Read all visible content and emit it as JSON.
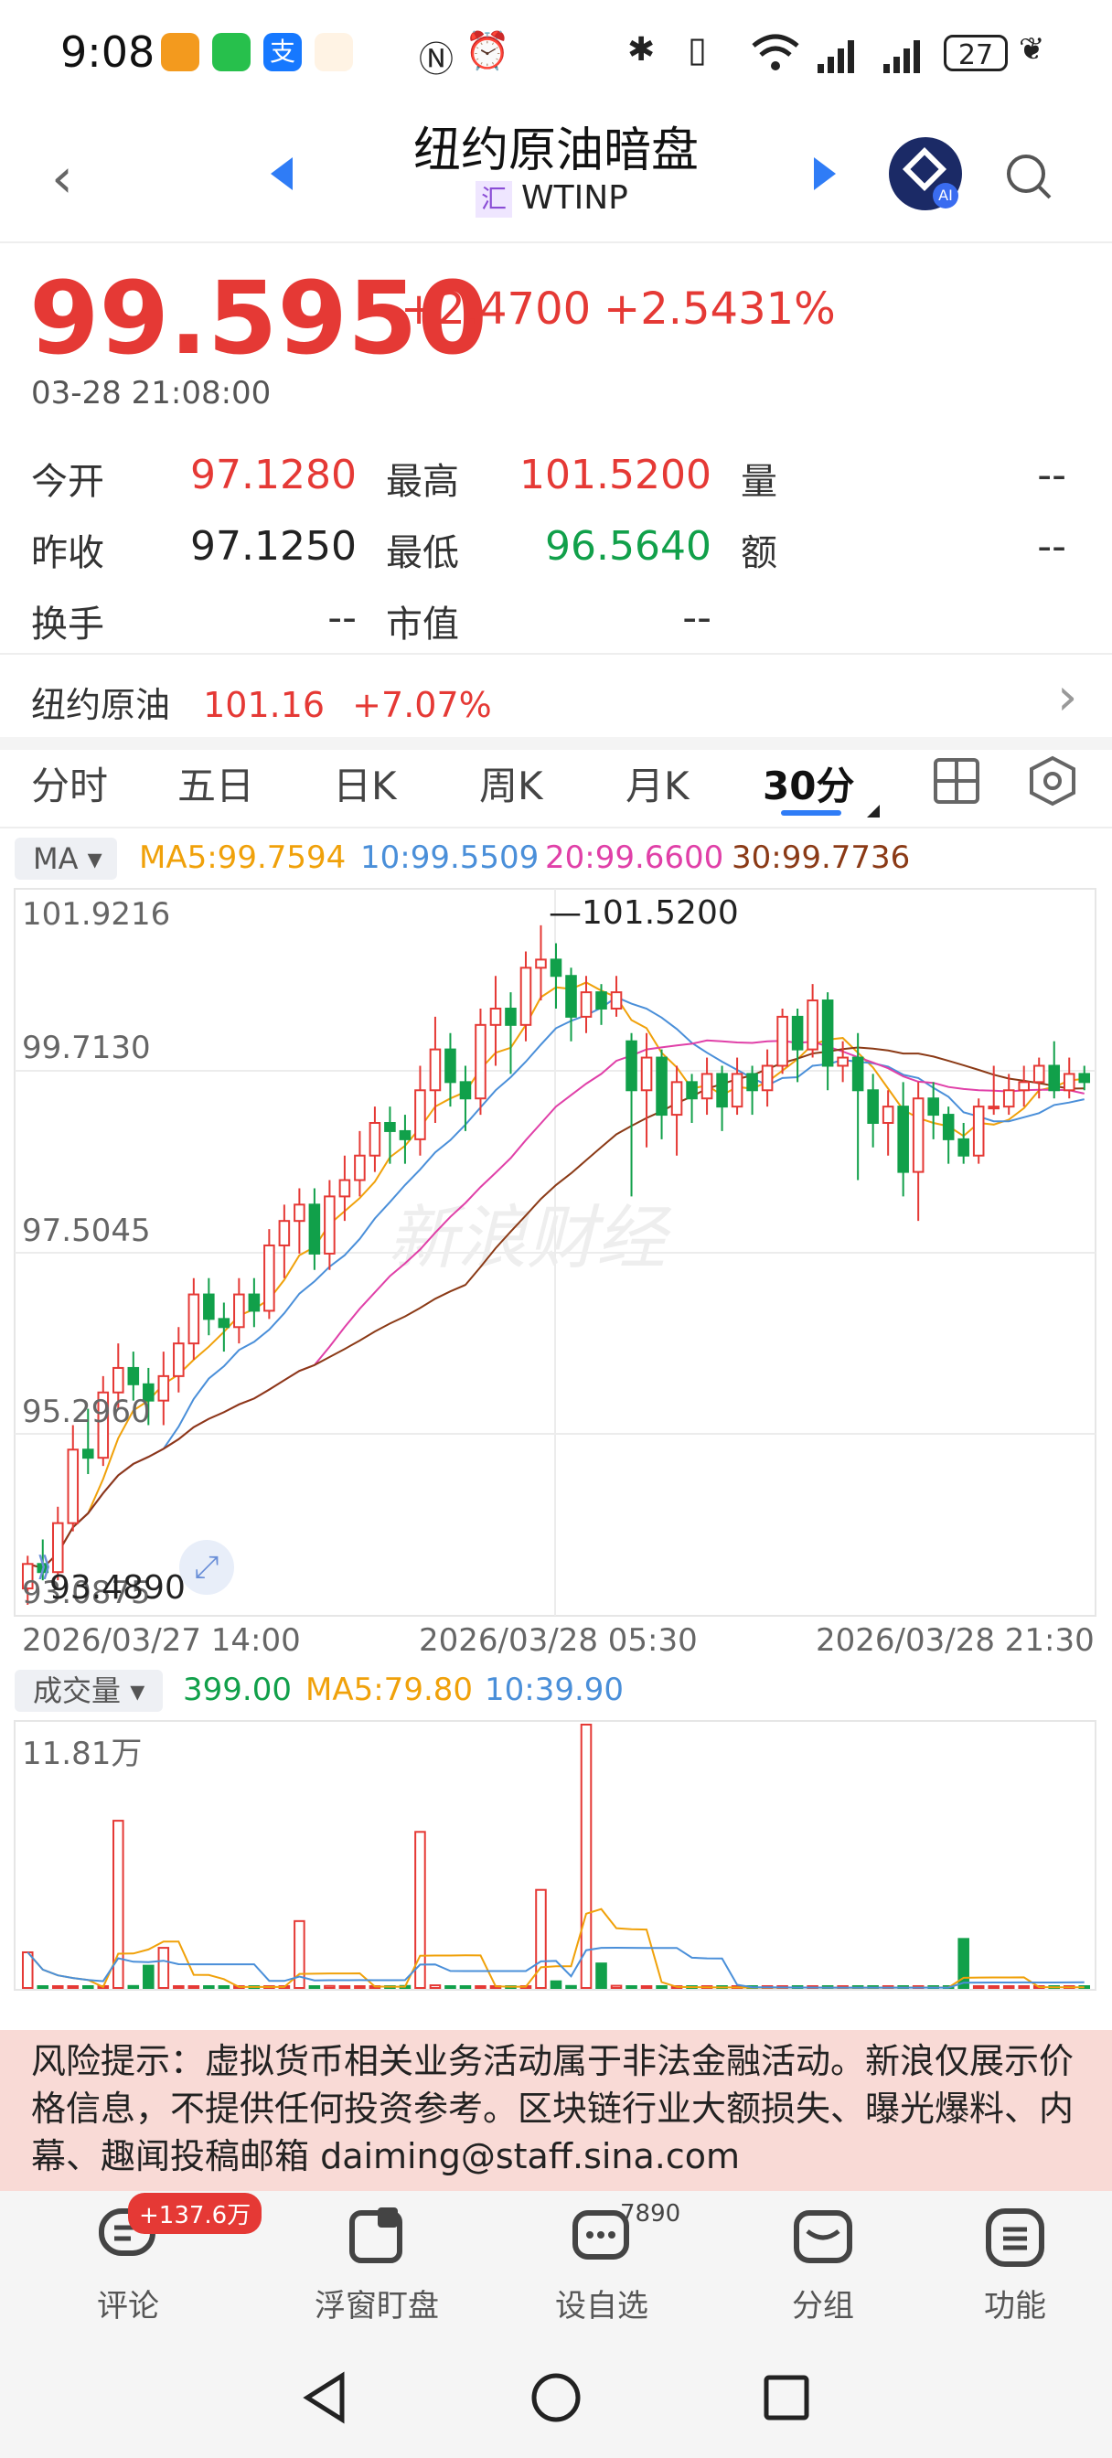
{
  "status_bar": {
    "time": "9:08",
    "battery": "27"
  },
  "header": {
    "title": "纽约原油暗盘",
    "subtitle_badge": "汇",
    "subtitle": "WTINP"
  },
  "quote": {
    "price": "99.5950",
    "change": "+2.4700",
    "change_pct": "+2.5431%",
    "timestamp": "03-28 21:08:00",
    "rows": [
      [
        {
          "l": "今开",
          "v": "97.1280",
          "c": "up"
        },
        {
          "l": "最高",
          "v": "101.5200",
          "c": "up"
        },
        {
          "l": "量",
          "v": "--",
          "c": "plain"
        }
      ],
      [
        {
          "l": "昨收",
          "v": "97.1250",
          "c": "plain"
        },
        {
          "l": "最低",
          "v": "96.5640",
          "c": "down"
        },
        {
          "l": "额",
          "v": "--",
          "c": "plain"
        }
      ],
      [
        {
          "l": "换手",
          "v": "--",
          "c": "plain"
        },
        {
          "l": "市值",
          "v": "--",
          "c": "plain"
        }
      ]
    ]
  },
  "related": {
    "name": "纽约原油",
    "price": "101.16",
    "pct": "+7.07%"
  },
  "tabs": [
    "分时",
    "五日",
    "日K",
    "周K",
    "月K",
    "30分"
  ],
  "ma_bar": {
    "button": "MA",
    "ma5": "MA5:99.7594",
    "ma10": "10:99.5509",
    "ma20": "20:99.6600",
    "ma30": "30:99.7736"
  },
  "price_chart": {
    "y_labels": [
      "101.9216",
      "99.7130",
      "97.5045",
      "95.2960",
      "93.0875"
    ],
    "high_label": "101.5200",
    "low_label": "93.4890",
    "x_labels": [
      "2026/03/27 14:00",
      "2026/03/28 05:30",
      "2026/03/28 21:30"
    ],
    "watermark": "新浪财经"
  },
  "volume_bar": {
    "button": "成交量",
    "vol": "399.00",
    "ma5": "MA5:79.80",
    "ma10": "10:39.90",
    "max_label": "11.81万"
  },
  "risk_notice": "风险提示：虚拟货币相关业务活动属于非法金融活动。新浪仅展示价格信息，不提供任何投资参考。区块链行业大额损失、曝光爆料、内幕、趣闻投稿邮箱 daiming@staff.sina.com",
  "bottom_actions": [
    {
      "label": "评论",
      "icon": "comment-icon",
      "badge": "+137.6万"
    },
    {
      "label": "浮窗盯盘",
      "icon": "float-window-icon",
      "badge": ""
    },
    {
      "label": "设自选",
      "icon": "add-watchlist-icon",
      "badge": "7890"
    },
    {
      "label": "分组",
      "icon": "group-icon",
      "badge": ""
    },
    {
      "label": "功能",
      "icon": "menu-icon",
      "badge": ""
    }
  ],
  "colors": {
    "up": "#e53935",
    "down": "#11a04a",
    "ma5": "#f0a10a",
    "ma10": "#4a8fd9",
    "ma20": "#e040a8",
    "ma30": "#8b3a16"
  },
  "chart_data": {
    "type": "candlestick",
    "ylim": [
      93.0875,
      101.9216
    ],
    "x_ticks": [
      "2026/03/27 14:00",
      "2026/03/28 05:30",
      "2026/03/28 21:30"
    ],
    "candles": [
      [
        93.4,
        93.7,
        93.2,
        93.8
      ],
      [
        93.7,
        93.6,
        93.5,
        94.0
      ],
      [
        93.6,
        94.2,
        93.5,
        94.4
      ],
      [
        94.2,
        95.1,
        94.1,
        95.4
      ],
      [
        95.1,
        95.0,
        94.8,
        95.6
      ],
      [
        95.0,
        95.8,
        94.9,
        96.0
      ],
      [
        95.8,
        96.1,
        95.6,
        96.4
      ],
      [
        96.1,
        95.9,
        95.7,
        96.3
      ],
      [
        95.9,
        95.7,
        95.4,
        96.1
      ],
      [
        95.7,
        96.0,
        95.4,
        96.3
      ],
      [
        96.0,
        96.4,
        95.8,
        96.6
      ],
      [
        96.4,
        97.0,
        96.2,
        97.2
      ],
      [
        97.0,
        96.7,
        96.5,
        97.2
      ],
      [
        96.7,
        96.6,
        96.3,
        96.9
      ],
      [
        96.6,
        97.0,
        96.4,
        97.2
      ],
      [
        97.0,
        96.8,
        96.6,
        97.2
      ],
      [
        96.8,
        97.6,
        96.7,
        97.8
      ],
      [
        97.6,
        97.9,
        97.2,
        98.1
      ],
      [
        97.9,
        98.1,
        97.5,
        98.3
      ],
      [
        98.1,
        97.5,
        97.3,
        98.3
      ],
      [
        97.5,
        98.2,
        97.3,
        98.4
      ],
      [
        98.2,
        98.4,
        97.9,
        98.7
      ],
      [
        98.4,
        98.7,
        98.2,
        99.0
      ],
      [
        98.7,
        99.1,
        98.5,
        99.3
      ],
      [
        99.1,
        99.0,
        98.6,
        99.3
      ],
      [
        99.0,
        98.9,
        98.6,
        99.2
      ],
      [
        98.9,
        99.5,
        98.7,
        99.8
      ],
      [
        99.5,
        100.0,
        99.1,
        100.4
      ],
      [
        100.0,
        99.6,
        99.3,
        100.2
      ],
      [
        99.6,
        99.4,
        99.0,
        99.8
      ],
      [
        99.4,
        100.3,
        99.2,
        100.5
      ],
      [
        100.3,
        100.5,
        99.8,
        100.9
      ],
      [
        100.5,
        100.3,
        99.7,
        100.7
      ],
      [
        100.3,
        101.0,
        100.1,
        101.2
      ],
      [
        101.0,
        101.1,
        100.6,
        101.52
      ],
      [
        101.1,
        100.9,
        100.5,
        101.3
      ],
      [
        100.9,
        100.4,
        100.1,
        101.0
      ],
      [
        100.4,
        100.7,
        100.2,
        100.9
      ],
      [
        100.7,
        100.5,
        100.3,
        100.8
      ],
      [
        100.5,
        100.7,
        100.4,
        100.9
      ],
      [
        100.1,
        99.5,
        98.2,
        100.2
      ],
      [
        99.5,
        99.9,
        98.8,
        100.2
      ],
      [
        99.9,
        99.2,
        98.9,
        100.0
      ],
      [
        99.2,
        99.6,
        98.7,
        99.8
      ],
      [
        99.6,
        99.4,
        99.1,
        99.7
      ],
      [
        99.4,
        99.7,
        99.2,
        99.9
      ],
      [
        99.7,
        99.3,
        99.0,
        99.8
      ],
      [
        99.3,
        99.7,
        99.2,
        99.9
      ],
      [
        99.7,
        99.5,
        99.2,
        99.8
      ],
      [
        99.5,
        99.8,
        99.3,
        100.0
      ],
      [
        99.8,
        100.4,
        99.7,
        100.5
      ],
      [
        100.4,
        100.0,
        99.6,
        100.5
      ],
      [
        100.0,
        100.6,
        99.9,
        100.8
      ],
      [
        100.6,
        99.8,
        99.5,
        100.7
      ],
      [
        99.8,
        99.9,
        99.6,
        100.1
      ],
      [
        99.9,
        99.5,
        98.4,
        100.2
      ],
      [
        99.5,
        99.1,
        98.8,
        99.7
      ],
      [
        99.1,
        99.3,
        98.7,
        99.5
      ],
      [
        99.3,
        98.5,
        98.2,
        99.6
      ],
      [
        98.5,
        99.4,
        97.9,
        99.6
      ],
      [
        99.4,
        99.2,
        98.9,
        99.6
      ],
      [
        99.2,
        98.9,
        98.6,
        99.3
      ],
      [
        98.9,
        98.7,
        98.6,
        99.1
      ],
      [
        98.7,
        99.3,
        98.6,
        99.4
      ],
      [
        99.3,
        99.3,
        99.2,
        99.8
      ],
      [
        99.3,
        99.5,
        99.2,
        99.7
      ],
      [
        99.5,
        99.6,
        99.3,
        99.8
      ],
      [
        99.6,
        99.8,
        99.4,
        99.9
      ],
      [
        99.8,
        99.5,
        99.4,
        100.1
      ],
      [
        99.5,
        99.7,
        99.4,
        99.9
      ],
      [
        99.7,
        99.6,
        99.5,
        99.8
      ]
    ],
    "volume_ylim": [
      0,
      118100
    ],
    "volume": [
      16000,
      500,
      500,
      800,
      200,
      300,
      75000,
      900,
      10000,
      18000,
      300,
      400,
      500,
      600,
      400,
      300,
      500,
      400,
      30000,
      800,
      900,
      400,
      800,
      400,
      300,
      900,
      70000,
      1200,
      400,
      600,
      800,
      600,
      500,
      400,
      44000,
      3000,
      900,
      118100,
      11000,
      1000,
      600,
      300,
      200,
      400,
      300,
      200,
      100,
      200,
      100,
      300,
      200,
      150,
      120,
      100,
      90,
      80,
      150,
      300,
      200,
      220,
      150,
      180,
      22000,
      800,
      400,
      300,
      300,
      200,
      200,
      500,
      399
    ]
  }
}
